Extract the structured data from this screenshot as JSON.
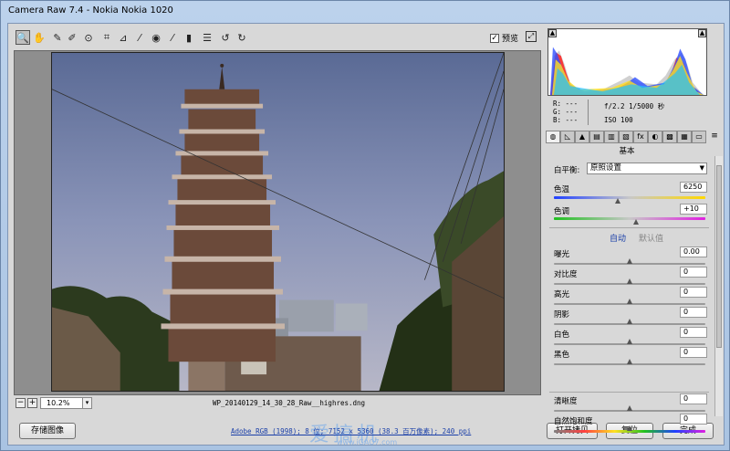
{
  "window": {
    "title": "Camera Raw 7.4  -  Nokia Nokia 1020"
  },
  "toolbar": {
    "tools": [
      {
        "icon": "zoom-icon",
        "glyph": "🔍"
      },
      {
        "icon": "hand-icon",
        "glyph": "✋"
      },
      {
        "icon": "white-balance-icon",
        "glyph": "✎"
      },
      {
        "icon": "color-sampler-icon",
        "glyph": "✐"
      },
      {
        "icon": "target-adjust-icon",
        "glyph": "⊙"
      },
      {
        "icon": "crop-icon",
        "glyph": "⌗"
      },
      {
        "icon": "straighten-icon",
        "glyph": "⊿"
      },
      {
        "icon": "spot-removal-icon",
        "glyph": "⁄"
      },
      {
        "icon": "red-eye-icon",
        "glyph": "◉"
      },
      {
        "icon": "adjustment-brush-icon",
        "glyph": "⁄"
      },
      {
        "icon": "graduated-filter-icon",
        "glyph": "▮"
      },
      {
        "icon": "preferences-icon",
        "glyph": "☰"
      },
      {
        "icon": "rotate-left-icon",
        "glyph": "↺"
      },
      {
        "icon": "rotate-right-icon",
        "glyph": "↻"
      }
    ],
    "preview_label": "预览",
    "preview_checked": true
  },
  "canvas": {
    "zoom": "10.2%",
    "filename": "WP_20140129_14_30_28_Raw__highres.dng"
  },
  "footer": {
    "save_label": "存储图像",
    "workflow_link": "Adobe RGB (1998); 8 位; 7152 x 5360 (38.3 百万像素); 240 ppi",
    "watermark": "爱搞机",
    "watermark_url": "www.iGAO7.com",
    "open_copy_label": "打开拷贝",
    "reset_label": "复位",
    "done_label": "完成"
  },
  "readout": {
    "r": "R:  ---",
    "g": "G:  ---",
    "b": "B:  ---",
    "exposure": "f/2.2  1/5000 秒",
    "iso": "ISO 100"
  },
  "panel": {
    "section_title": "基本",
    "wb_label": "白平衡:",
    "wb_value": "原照设置",
    "temp_label": "色温",
    "temp_value": "6250",
    "tint_label": "色调",
    "tint_value": "+10",
    "auto_label": "自动",
    "default_label": "默认值",
    "tone": [
      {
        "label": "曝光",
        "value": "0.00",
        "pos": 0.5
      },
      {
        "label": "对比度",
        "value": "0",
        "pos": 0.5
      },
      {
        "label": "高光",
        "value": "0",
        "pos": 0.5
      },
      {
        "label": "阴影",
        "value": "0",
        "pos": 0.5
      },
      {
        "label": "白色",
        "value": "0",
        "pos": 0.5
      },
      {
        "label": "黑色",
        "value": "0",
        "pos": 0.5
      }
    ],
    "presence": [
      {
        "label": "清晰度",
        "value": "0",
        "pos": 0.5
      },
      {
        "label": "自然饱和度",
        "value": "0",
        "pos": 0.5
      }
    ],
    "temp_pos": 0.42,
    "tint_pos": 0.54
  },
  "tabs": [
    "basic-tab-icon",
    "tone-curve-tab-icon",
    "detail-tab-icon",
    "hsl-tab-icon",
    "split-toning-tab-icon",
    "lens-tab-icon",
    "fx-tab-icon",
    "camera-calibration-tab-icon",
    "presets-tab-icon",
    "settings-tab-icon",
    "snapshots-tab-icon"
  ],
  "colors": {
    "accent_link": "#1a3fa8",
    "watermark": "#8fb6e6"
  }
}
